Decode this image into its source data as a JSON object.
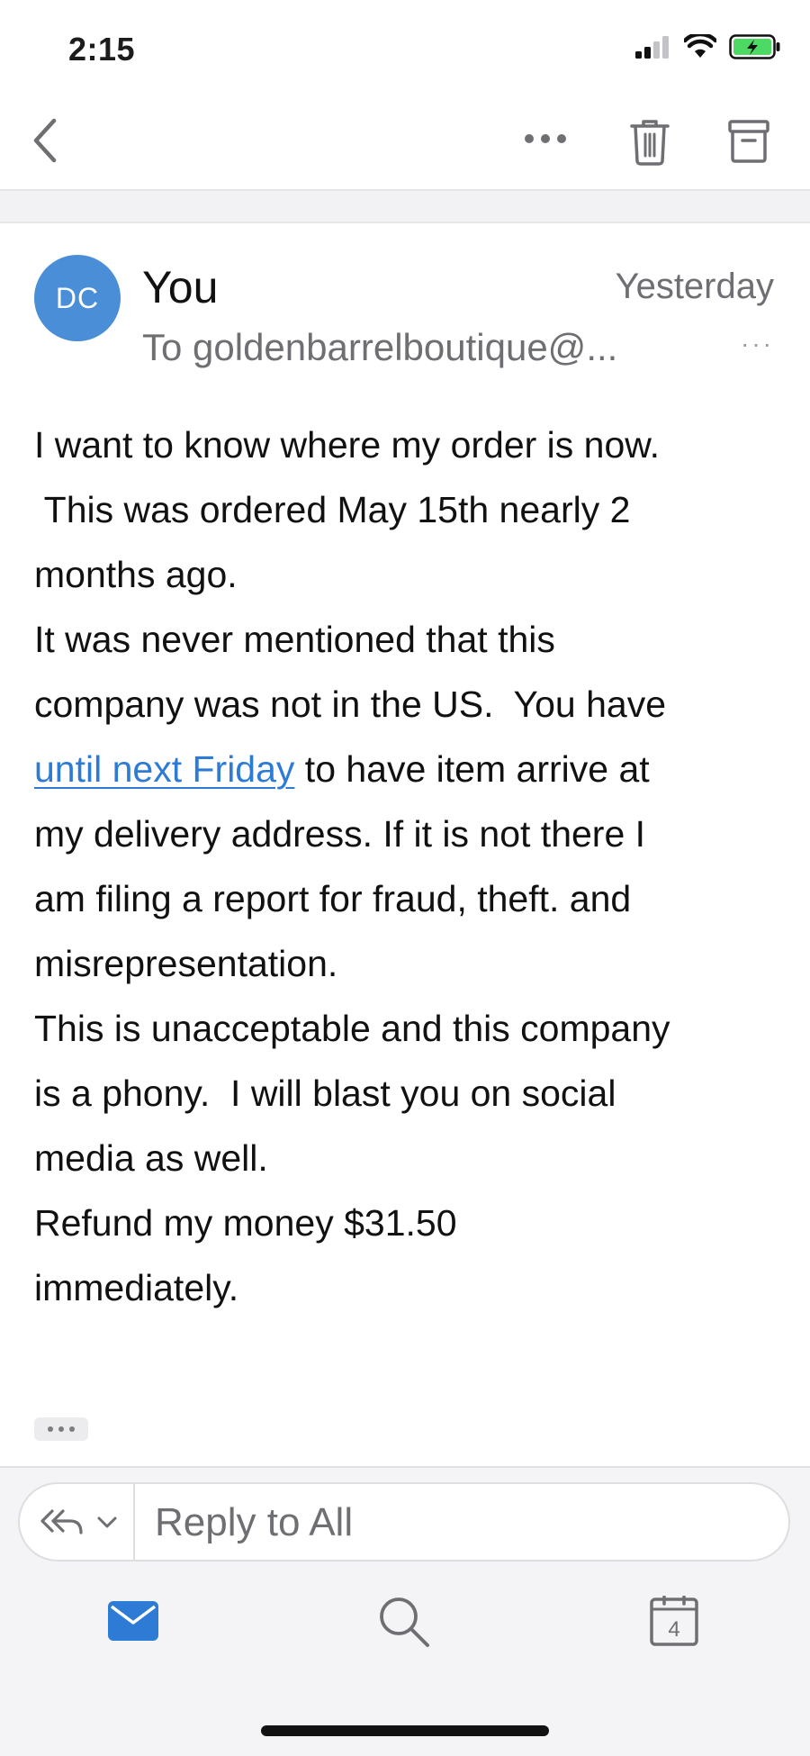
{
  "status_bar": {
    "time": "2:15",
    "icons": [
      "cellular-signal-icon",
      "wifi-icon",
      "battery-charging-icon"
    ],
    "battery_color": "#4cd964"
  },
  "toolbar": {
    "icons": [
      "back-chevron-icon",
      "more-horizontal-icon",
      "trash-icon",
      "archive-icon"
    ]
  },
  "message": {
    "avatar_initials": "DC",
    "avatar_color": "#4a8ed8",
    "sender": "You",
    "date": "Yesterday",
    "recipient": "To goldenbarrelboutique@...",
    "header_more": "···",
    "body": {
      "line1": "I want to know where my order is now.",
      "line2": " This was ordered May 15th nearly 2",
      "line3": "months ago.",
      "line4": "It was never mentioned that this",
      "line5": "company was not in the US.  You have",
      "line6_link": "until next Friday",
      "line6_rest": " to have item arrive at",
      "line7": "my delivery address. If it is not there I",
      "line8": "am filing a report for fraud, theft. and",
      "line9": "misrepresentation.",
      "line10": "This is unacceptable and this company",
      "line11": "is a phony.  I will blast you on social",
      "line12": "media as well.",
      "line13": "Refund my money $31.50",
      "line14": "immediately."
    },
    "link_color": "#2e7bd6"
  },
  "reply": {
    "placeholder": "Reply to All",
    "icons": [
      "reply-all-icon",
      "chevron-down-icon"
    ]
  },
  "tab_bar": {
    "tabs": [
      {
        "name": "mail",
        "icon": "mail-icon",
        "active": true
      },
      {
        "name": "search",
        "icon": "search-icon",
        "active": false
      },
      {
        "name": "calendar",
        "icon": "calendar-icon",
        "active": false,
        "day": "4"
      }
    ],
    "accent": "#2e7bd6"
  }
}
